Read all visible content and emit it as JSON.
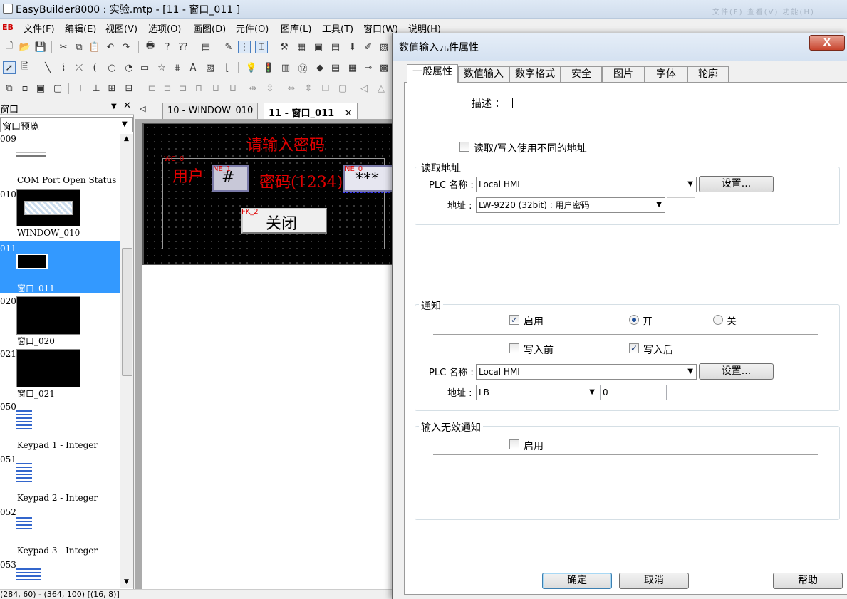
{
  "app": {
    "title": "EasyBuilder8000 : 实验.mtp - [11 - 窗口_011 ]",
    "title_right_faint": "文件(F) 查看(V) 功能(H)",
    "logo": "EB"
  },
  "menu": [
    "文件(F)",
    "编辑(E)",
    "视图(V)",
    "选项(O)",
    "画图(D)",
    "元件(O)",
    "图库(L)",
    "工具(T)",
    "窗口(W)",
    "说明(H)"
  ],
  "left_panel": {
    "title": "窗口",
    "dropdown": "窗口预览",
    "items": [
      {
        "id": "009",
        "name": ""
      },
      {
        "id": "",
        "name": "COM Port Open Status"
      },
      {
        "id": "010",
        "name": "WINDOW_010"
      },
      {
        "id": "011",
        "name": "窗口_011"
      },
      {
        "id": "020",
        "name": "窗口_020"
      },
      {
        "id": "021",
        "name": "窗口_021"
      },
      {
        "id": "050",
        "name": "Keypad 1 - Integer"
      },
      {
        "id": "051",
        "name": "Keypad 2 - Integer"
      },
      {
        "id": "052",
        "name": "Keypad 3 - Integer"
      },
      {
        "id": "053",
        "name": ""
      }
    ]
  },
  "doc_tabs": [
    "10 - WINDOW_010",
    "11 - 窗口_011"
  ],
  "canvas": {
    "heading": "请输入密码",
    "user_label": "用户",
    "password_label": "密码(1234)",
    "hash": "#",
    "stars": "***",
    "close_btn": "关闭",
    "tag_wc": "WC_0",
    "tag_ne1": "NE_1",
    "tag_ne0": "NE_0",
    "tag_fk": "FK_2"
  },
  "status": "(284, 60) - (364, 100) [(16, 8)]",
  "dialog": {
    "title": "数值输入元件属性",
    "close": "X",
    "tabs": [
      "一般属性",
      "数值输入",
      "数字格式",
      "安全",
      "图片",
      "字体",
      "轮廓"
    ],
    "desc_label": "描述 ：",
    "desc_value": "",
    "rw_diff_label": "读取/写入使用不同的地址",
    "read_group": {
      "title": "读取地址",
      "plc_label": "PLC 名称 :",
      "plc_value": "Local HMI",
      "settings": "设置...",
      "addr_label": "地址 :",
      "addr_value": "LW-9220 (32bit) : 用户密码"
    },
    "notify_group": {
      "title": "通知",
      "enable": "启用",
      "on": "开",
      "off": "关",
      "before_write": "写入前",
      "after_write": "写入后",
      "plc_label": "PLC 名称 :",
      "plc_value": "Local HMI",
      "settings": "设置...",
      "addr_label": "地址 :",
      "addr_type": "LB",
      "addr_value": "0"
    },
    "invalid_group": {
      "title": "输入无效通知",
      "enable": "启用"
    },
    "ok": "确定",
    "cancel": "取消",
    "help": "帮助",
    "check": "✓"
  },
  "colors": {
    "selection": "#3399ff",
    "canvas_text": "#e00000"
  }
}
